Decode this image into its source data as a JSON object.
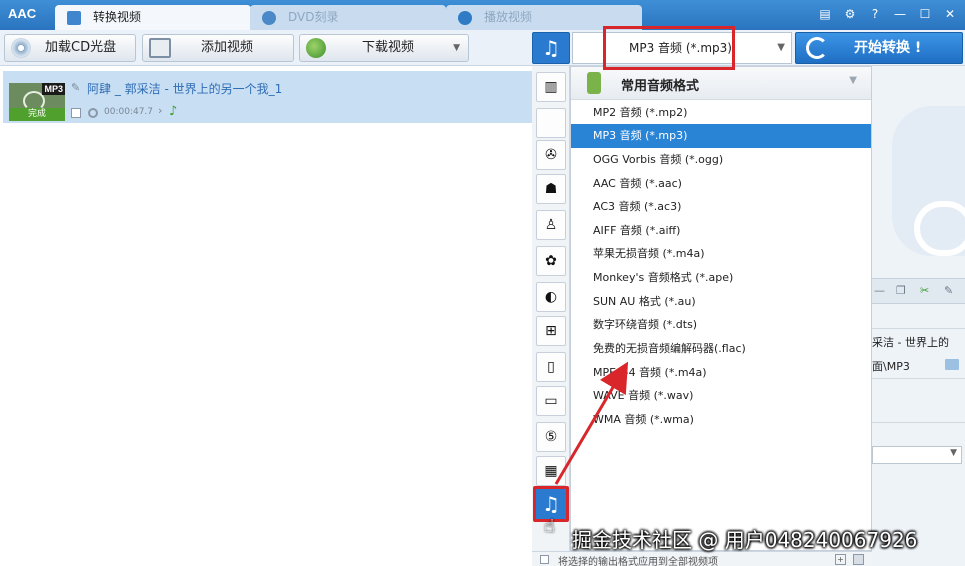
{
  "app": {
    "logo": "AAC",
    "tabs": [
      {
        "label": "转换视频",
        "active": true
      },
      {
        "label": "DVD刻录",
        "active": false
      },
      {
        "label": "播放视频",
        "active": false
      }
    ],
    "window_controls": [
      "menu-icon",
      "gear-icon",
      "help-icon",
      "minimize-icon",
      "maximize-icon",
      "close-icon"
    ],
    "window_control_glyphs": [
      "▤",
      "⚙",
      "?",
      "—",
      "☐",
      "✕"
    ]
  },
  "toolbar": {
    "load_cd_label": "加载CD光盘",
    "add_video_label": "添加视频",
    "download_video_label": "下载视频",
    "format_selected": "MP3 音频 (*.mp3)",
    "start_label": "开始转换 !"
  },
  "file_list": {
    "items": [
      {
        "badge": "MP3",
        "status": "完成",
        "name": "阿肆 _ 郭采洁 - 世界上的另一个我_1",
        "duration": "00:00:47.7"
      }
    ]
  },
  "categories": [
    {
      "name": "audio-bars-icon",
      "glyph": "▥",
      "active": false
    },
    {
      "name": "apple-icon",
      "glyph": "",
      "active": false
    },
    {
      "name": "android-settings-icon",
      "glyph": "✇",
      "active": false
    },
    {
      "name": "android-icon",
      "glyph": "☗",
      "active": false
    },
    {
      "name": "playstation-icon",
      "glyph": "♙",
      "active": false
    },
    {
      "name": "huawei-icon",
      "glyph": "✿",
      "active": false
    },
    {
      "name": "lg-icon",
      "glyph": "◐",
      "active": false
    },
    {
      "name": "windows-icon",
      "glyph": "⊞",
      "active": false
    },
    {
      "name": "phone-icon",
      "glyph": "▯",
      "active": false
    },
    {
      "name": "tv-icon",
      "glyph": "▭",
      "active": false
    },
    {
      "name": "html5-icon",
      "glyph": "⑤",
      "active": false
    },
    {
      "name": "film-icon",
      "glyph": "▦",
      "active": false
    },
    {
      "name": "music-note-icon",
      "glyph": "♫",
      "active": true
    }
  ],
  "format_panel": {
    "group_label": "常用音频格式",
    "items": [
      {
        "label": "MP2 音频 (*.mp2)",
        "selected": false
      },
      {
        "label": "MP3 音频 (*.mp3)",
        "selected": true
      },
      {
        "label": "OGG Vorbis 音频 (*.ogg)",
        "selected": false
      },
      {
        "label": "AAC 音频 (*.aac)",
        "selected": false
      },
      {
        "label": "AC3 音频 (*.ac3)",
        "selected": false
      },
      {
        "label": "AIFF 音频 (*.aiff)",
        "selected": false
      },
      {
        "label": "苹果无损音频 (*.m4a)",
        "selected": false
      },
      {
        "label": "Monkey's 音频格式 (*.ape)",
        "selected": false
      },
      {
        "label": "SUN AU 格式 (*.au)",
        "selected": false
      },
      {
        "label": "数字环绕音频 (*.dts)",
        "selected": false
      },
      {
        "label": "免费的无损音频编解码器(.flac)",
        "selected": false
      },
      {
        "label": "MPEG-4 音频 (*.m4a)",
        "selected": false
      },
      {
        "label": "WAVE 音频 (*.wav)",
        "selected": false
      },
      {
        "label": "WMA 音频 (*.wma)",
        "selected": false
      }
    ]
  },
  "right_panel": {
    "text1": "采洁 - 世界上的",
    "text2": "面\\MP3"
  },
  "bottom_bar": {
    "apply_all_label": "将选择的输出格式应用到全部视频项"
  },
  "watermark": "掘金技术社区 @ 用户048240067926",
  "colors": {
    "accent": "#2a84d6",
    "highlight": "#d8262b",
    "done_green": "#4fa02c"
  }
}
